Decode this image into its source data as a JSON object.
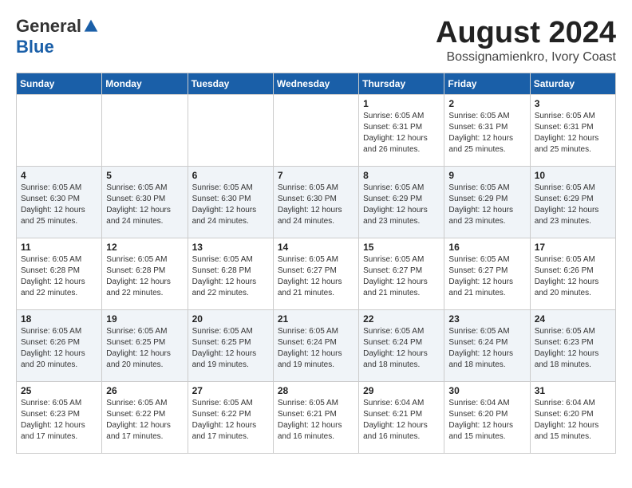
{
  "logo": {
    "general": "General",
    "blue": "Blue"
  },
  "title": {
    "month": "August 2024",
    "location": "Bossignamienkro, Ivory Coast"
  },
  "headers": [
    "Sunday",
    "Monday",
    "Tuesday",
    "Wednesday",
    "Thursday",
    "Friday",
    "Saturday"
  ],
  "weeks": [
    [
      {
        "day": "",
        "detail": ""
      },
      {
        "day": "",
        "detail": ""
      },
      {
        "day": "",
        "detail": ""
      },
      {
        "day": "",
        "detail": ""
      },
      {
        "day": "1",
        "detail": "Sunrise: 6:05 AM\nSunset: 6:31 PM\nDaylight: 12 hours\nand 26 minutes."
      },
      {
        "day": "2",
        "detail": "Sunrise: 6:05 AM\nSunset: 6:31 PM\nDaylight: 12 hours\nand 25 minutes."
      },
      {
        "day": "3",
        "detail": "Sunrise: 6:05 AM\nSunset: 6:31 PM\nDaylight: 12 hours\nand 25 minutes."
      }
    ],
    [
      {
        "day": "4",
        "detail": "Sunrise: 6:05 AM\nSunset: 6:30 PM\nDaylight: 12 hours\nand 25 minutes."
      },
      {
        "day": "5",
        "detail": "Sunrise: 6:05 AM\nSunset: 6:30 PM\nDaylight: 12 hours\nand 24 minutes."
      },
      {
        "day": "6",
        "detail": "Sunrise: 6:05 AM\nSunset: 6:30 PM\nDaylight: 12 hours\nand 24 minutes."
      },
      {
        "day": "7",
        "detail": "Sunrise: 6:05 AM\nSunset: 6:30 PM\nDaylight: 12 hours\nand 24 minutes."
      },
      {
        "day": "8",
        "detail": "Sunrise: 6:05 AM\nSunset: 6:29 PM\nDaylight: 12 hours\nand 23 minutes."
      },
      {
        "day": "9",
        "detail": "Sunrise: 6:05 AM\nSunset: 6:29 PM\nDaylight: 12 hours\nand 23 minutes."
      },
      {
        "day": "10",
        "detail": "Sunrise: 6:05 AM\nSunset: 6:29 PM\nDaylight: 12 hours\nand 23 minutes."
      }
    ],
    [
      {
        "day": "11",
        "detail": "Sunrise: 6:05 AM\nSunset: 6:28 PM\nDaylight: 12 hours\nand 22 minutes."
      },
      {
        "day": "12",
        "detail": "Sunrise: 6:05 AM\nSunset: 6:28 PM\nDaylight: 12 hours\nand 22 minutes."
      },
      {
        "day": "13",
        "detail": "Sunrise: 6:05 AM\nSunset: 6:28 PM\nDaylight: 12 hours\nand 22 minutes."
      },
      {
        "day": "14",
        "detail": "Sunrise: 6:05 AM\nSunset: 6:27 PM\nDaylight: 12 hours\nand 21 minutes."
      },
      {
        "day": "15",
        "detail": "Sunrise: 6:05 AM\nSunset: 6:27 PM\nDaylight: 12 hours\nand 21 minutes."
      },
      {
        "day": "16",
        "detail": "Sunrise: 6:05 AM\nSunset: 6:27 PM\nDaylight: 12 hours\nand 21 minutes."
      },
      {
        "day": "17",
        "detail": "Sunrise: 6:05 AM\nSunset: 6:26 PM\nDaylight: 12 hours\nand 20 minutes."
      }
    ],
    [
      {
        "day": "18",
        "detail": "Sunrise: 6:05 AM\nSunset: 6:26 PM\nDaylight: 12 hours\nand 20 minutes."
      },
      {
        "day": "19",
        "detail": "Sunrise: 6:05 AM\nSunset: 6:25 PM\nDaylight: 12 hours\nand 20 minutes."
      },
      {
        "day": "20",
        "detail": "Sunrise: 6:05 AM\nSunset: 6:25 PM\nDaylight: 12 hours\nand 19 minutes."
      },
      {
        "day": "21",
        "detail": "Sunrise: 6:05 AM\nSunset: 6:24 PM\nDaylight: 12 hours\nand 19 minutes."
      },
      {
        "day": "22",
        "detail": "Sunrise: 6:05 AM\nSunset: 6:24 PM\nDaylight: 12 hours\nand 18 minutes."
      },
      {
        "day": "23",
        "detail": "Sunrise: 6:05 AM\nSunset: 6:24 PM\nDaylight: 12 hours\nand 18 minutes."
      },
      {
        "day": "24",
        "detail": "Sunrise: 6:05 AM\nSunset: 6:23 PM\nDaylight: 12 hours\nand 18 minutes."
      }
    ],
    [
      {
        "day": "25",
        "detail": "Sunrise: 6:05 AM\nSunset: 6:23 PM\nDaylight: 12 hours\nand 17 minutes."
      },
      {
        "day": "26",
        "detail": "Sunrise: 6:05 AM\nSunset: 6:22 PM\nDaylight: 12 hours\nand 17 minutes."
      },
      {
        "day": "27",
        "detail": "Sunrise: 6:05 AM\nSunset: 6:22 PM\nDaylight: 12 hours\nand 17 minutes."
      },
      {
        "day": "28",
        "detail": "Sunrise: 6:05 AM\nSunset: 6:21 PM\nDaylight: 12 hours\nand 16 minutes."
      },
      {
        "day": "29",
        "detail": "Sunrise: 6:04 AM\nSunset: 6:21 PM\nDaylight: 12 hours\nand 16 minutes."
      },
      {
        "day": "30",
        "detail": "Sunrise: 6:04 AM\nSunset: 6:20 PM\nDaylight: 12 hours\nand 15 minutes."
      },
      {
        "day": "31",
        "detail": "Sunrise: 6:04 AM\nSunset: 6:20 PM\nDaylight: 12 hours\nand 15 minutes."
      }
    ]
  ]
}
